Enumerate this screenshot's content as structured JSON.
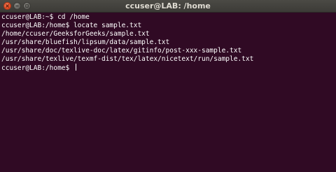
{
  "window": {
    "title": "ccuser@LAB: /home",
    "buttons": {
      "close_icon": "close-icon",
      "minimize_icon": "minimize-icon",
      "maximize_icon": "maximize-icon"
    }
  },
  "terminal": {
    "background": "#300a24",
    "foreground": "#ffffff",
    "lines": [
      "ccuser@LAB:~$ cd /home",
      "ccuser@LAB:/home$ locate sample.txt",
      "/home/ccuser/GeeksforGeeks/sample.txt",
      "/usr/share/bluefish/lipsum/data/sample.txt",
      "/usr/share/doc/texlive-doc/latex/gitinfo/post-xxx-sample.txt",
      "/usr/share/texlive/texmf-dist/tex/latex/nicetext/run/sample.txt",
      "ccuser@LAB:/home$ "
    ]
  }
}
